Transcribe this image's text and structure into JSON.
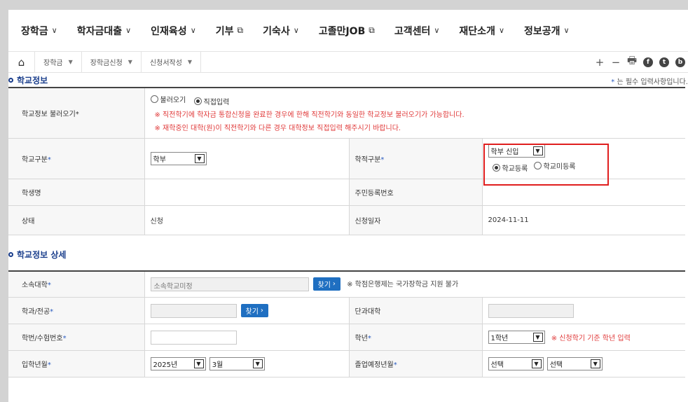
{
  "gnb": {
    "items": [
      {
        "label": "장학금",
        "type": "dropdown"
      },
      {
        "label": "학자금대출",
        "type": "dropdown"
      },
      {
        "label": "인재육성",
        "type": "dropdown"
      },
      {
        "label": "기부",
        "type": "external"
      },
      {
        "label": "기숙사",
        "type": "dropdown"
      },
      {
        "label": "고졸만JOB",
        "type": "external"
      },
      {
        "label": "고객센터",
        "type": "dropdown"
      },
      {
        "label": "재단소개",
        "type": "dropdown"
      },
      {
        "label": "정보공개",
        "type": "dropdown"
      }
    ]
  },
  "breadcrumb": {
    "items": [
      "장학금",
      "장학금신청",
      "신청서작성"
    ],
    "tools": [
      "plus",
      "minus",
      "print",
      "facebook",
      "twitter",
      "blog"
    ]
  },
  "school_info": {
    "title": "학교정보",
    "required_note_star": "*",
    "required_note": "는 필수 입력사항입니다.",
    "load_label": "학교정보 불러오기*",
    "radio_load": "불러오기",
    "radio_direct": "직접입력",
    "notice1": "※ 직전학기에 학자금 통합신청을 완료한 경우에 한해 직전학기와 동일한 학교정보 불러오기가 가능합니다.",
    "notice2": "※ 재학중인 대학(원)이 직전학기와 다른 경우 대학정보 직접입력 해주시기 바랍니다.",
    "school_type_label": "학교구분",
    "school_type_value": "학부",
    "academic_status_label": "학적구분",
    "academic_status_value": "학부 신입",
    "radio_registered": "학교등록",
    "radio_unregistered": "학교미등록",
    "student_name_label": "학생명",
    "student_name_value": "",
    "resident_no_label": "주민등록번호",
    "resident_no_value": "",
    "status_label": "상태",
    "status_value": "신청",
    "apply_date_label": "신청일자",
    "apply_date_value": "2024-11-11"
  },
  "school_detail": {
    "title": "학교정보 상세",
    "university_label": "소속대학",
    "university_placeholder": "소속학교미정",
    "find_button": "찾기",
    "credit_bank_note": "※ 학점은행제는 국가장학금 지원 불가",
    "major_label": "학과/전공",
    "college_label": "단과대학",
    "student_no_label": "학번/수험번호",
    "grade_label": "학년",
    "grade_value": "1학년",
    "grade_note": "※ 신청학기 기준 학년 입력",
    "admission_label": "입학년월",
    "admission_year": "2025년",
    "admission_month": "3월",
    "graduation_label": "졸업예정년월",
    "graduation_year": "선택",
    "graduation_month": "선택"
  },
  "colors": {
    "accent_blue": "#1f6fc1",
    "title_navy": "#1a3e8c",
    "notice_red": "#e03a3a",
    "highlight_red": "#e01e1e"
  }
}
